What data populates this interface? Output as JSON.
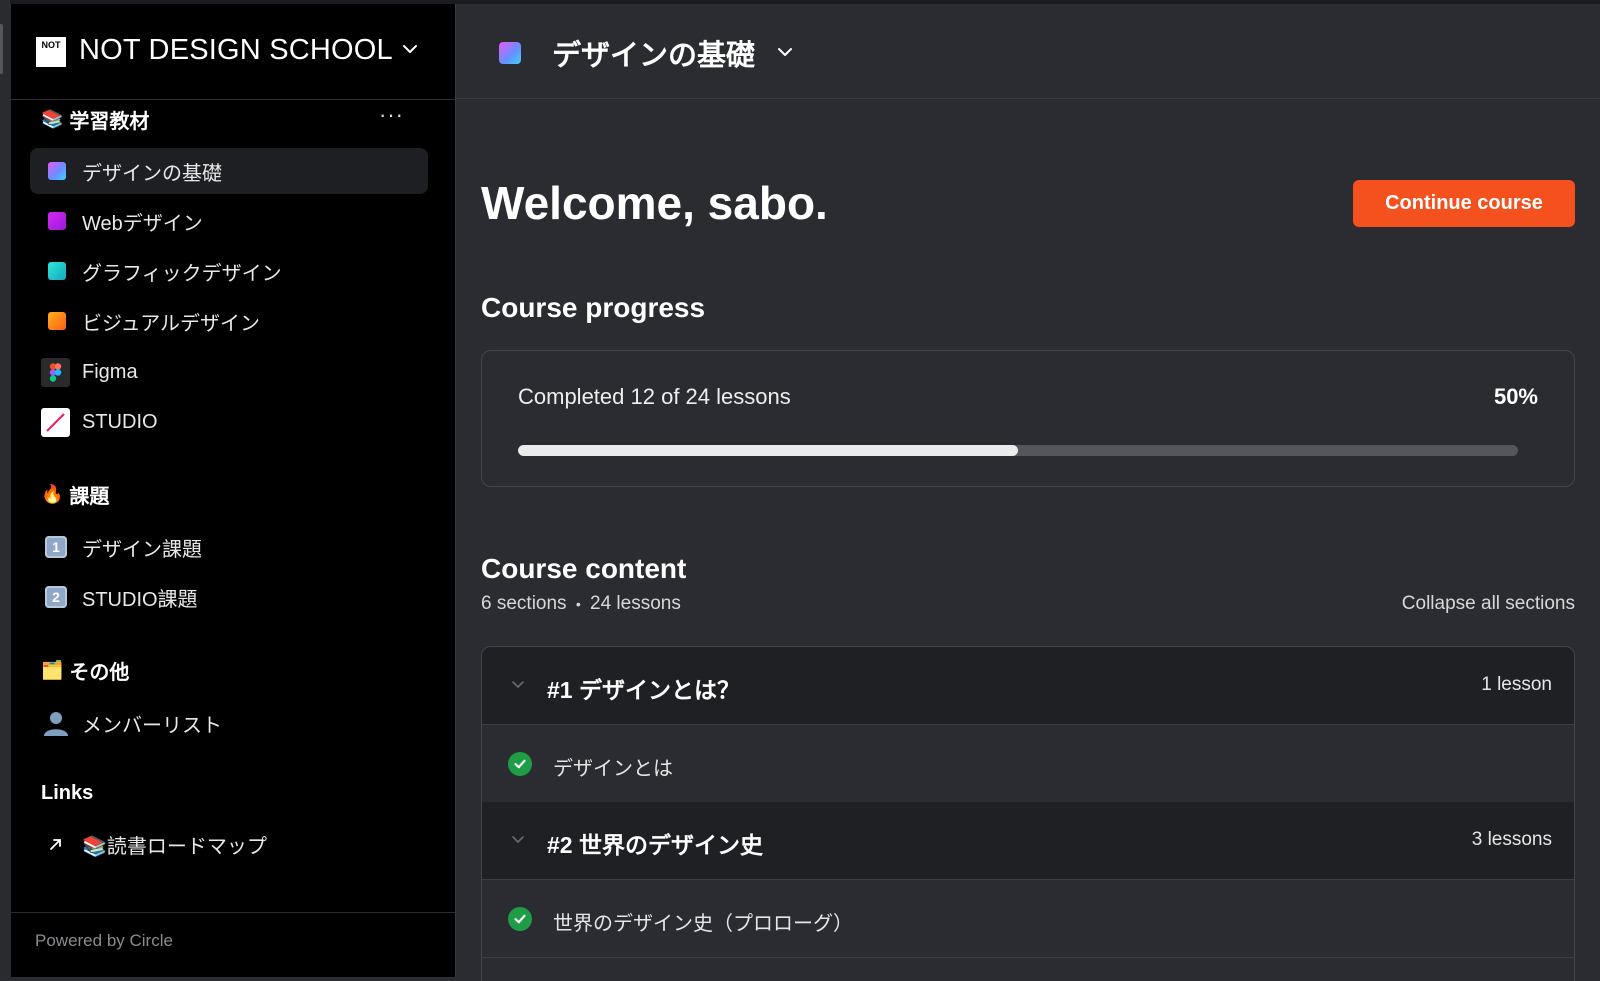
{
  "sidebar": {
    "brand_logo_text": "NOT",
    "brand_name": "NOT DESIGN SCHOOL",
    "sections": [
      {
        "emoji": "📚",
        "title": "学習教材"
      },
      {
        "emoji": "🔥",
        "title": "課題"
      },
      {
        "emoji": "🗂️",
        "title": "その他"
      },
      {
        "emoji": "",
        "title": "Links"
      }
    ],
    "more_label": "···",
    "items": [
      {
        "label": "デザインの基礎",
        "icon": "gradient-square-icon",
        "color": "#6f7cff"
      },
      {
        "label": "Webデザイン",
        "icon": "purple-square-icon",
        "color": "#b41de6"
      },
      {
        "label": "グラフィックデザイン",
        "icon": "teal-square-icon",
        "color": "#1ec8c4"
      },
      {
        "label": "ビジュアルデザイン",
        "icon": "orange-square-icon",
        "color": "#ff8a1a"
      },
      {
        "label": "Figma",
        "icon": "figma-icon"
      },
      {
        "label": "STUDIO",
        "icon": "studio-icon"
      },
      {
        "label": "デザイン課題",
        "icon": "keycap-1-icon",
        "num": "1"
      },
      {
        "label": "STUDIO課題",
        "icon": "keycap-2-icon",
        "num": "2"
      },
      {
        "label": "メンバーリスト",
        "icon": "person-icon"
      },
      {
        "label": "📚読書ロードマップ",
        "icon": "external-link-arrow-icon"
      }
    ],
    "powered_by": "Powered by Circle"
  },
  "topbar": {
    "title": "デザインの基礎"
  },
  "main": {
    "welcome": "Welcome, sabo.",
    "continue_button": "Continue course",
    "progress_heading": "Course progress",
    "progress_text": "Completed 12 of 24 lessons",
    "progress_percent_label": "50%",
    "progress_value": 0.5,
    "content_heading": "Course content",
    "sections_count": "6 sections",
    "lessons_count": "24 lessons",
    "separator": "•",
    "collapse_label": "Collapse all sections",
    "course_sections": [
      {
        "title": "#1 デザインとは？",
        "count": "1 lesson",
        "lessons": [
          {
            "title": "デザインとは",
            "completed": true
          }
        ]
      },
      {
        "title": "#2 世界のデザイン史",
        "count": "3 lessons",
        "lessons": [
          {
            "title": "世界のデザイン史（プロローグ）",
            "completed": true
          }
        ]
      }
    ]
  },
  "colors": {
    "accent": "#f4511e",
    "success": "#1f9d46",
    "sidebar_bg": "#000000",
    "main_bg": "#2b2c31"
  }
}
